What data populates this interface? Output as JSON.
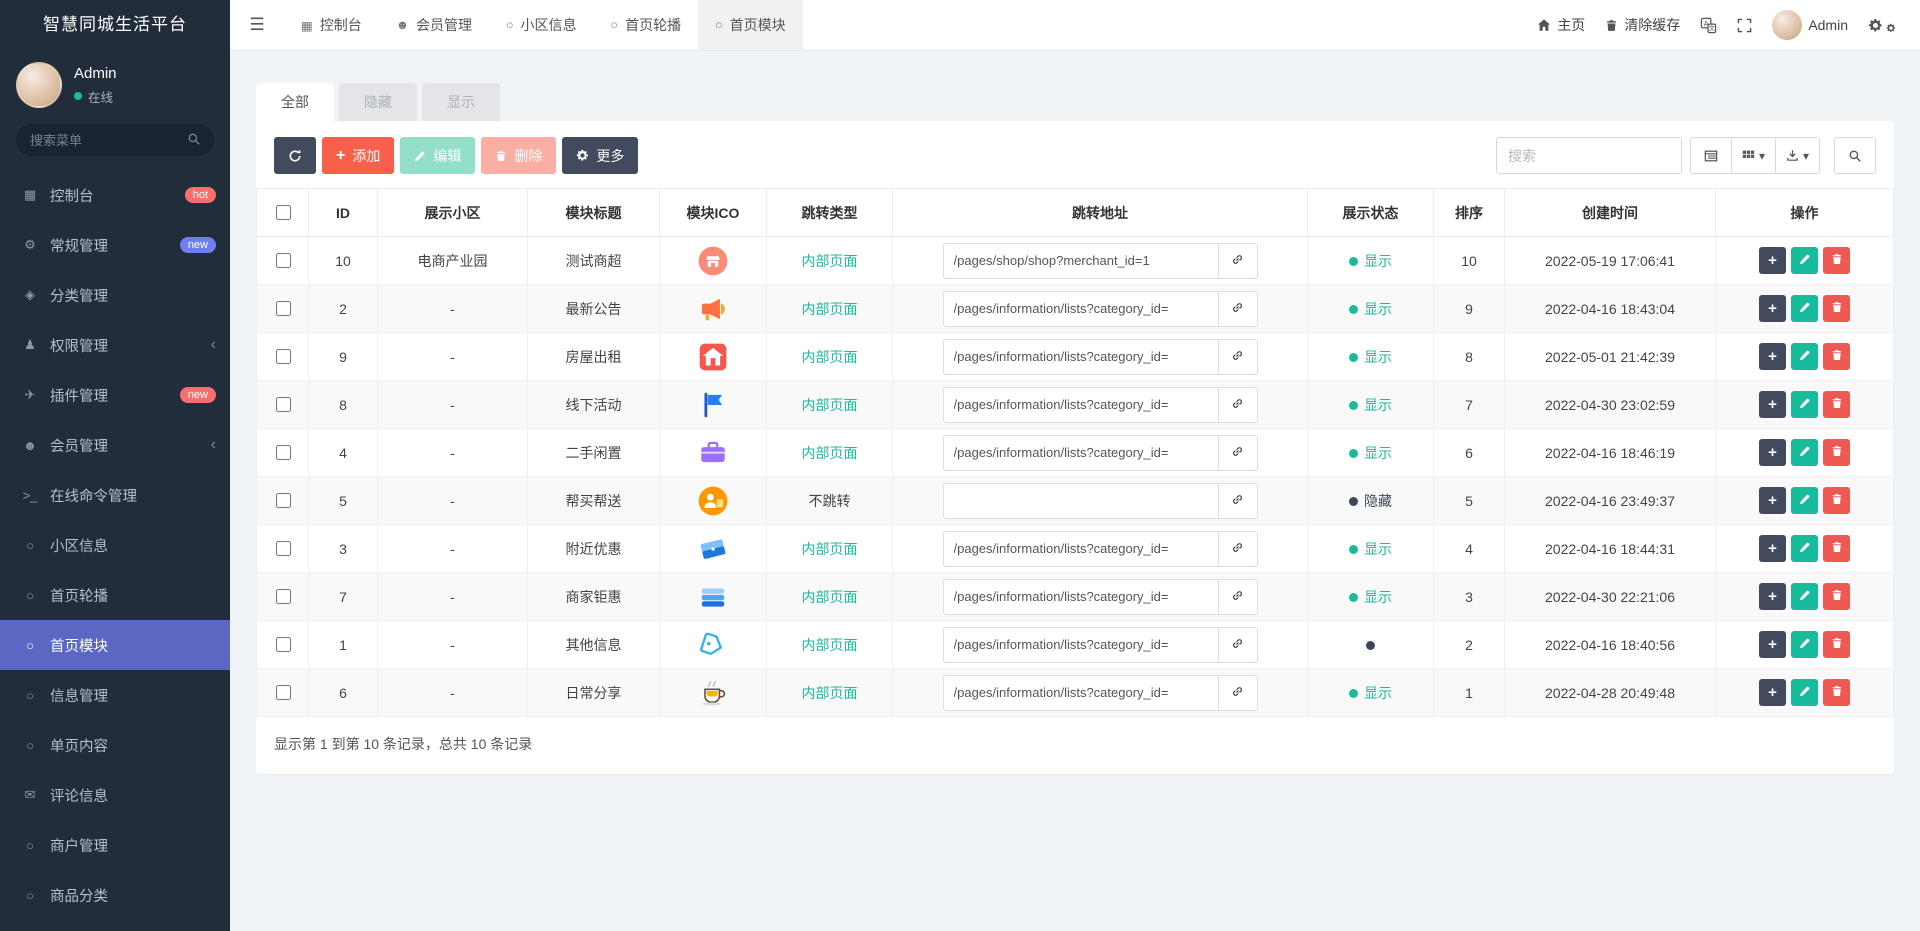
{
  "app": {
    "title": "智慧同城生活平台"
  },
  "colors": {
    "accent_green": "#18bc9c",
    "coral": "#f8604b",
    "dark_button": "#424a5e",
    "active_menu": "#5a68c4",
    "danger": "#ee5a52"
  },
  "sidebar": {
    "user": {
      "name": "Admin",
      "status": "在线"
    },
    "search_placeholder": "搜索菜单",
    "menu": [
      {
        "label": "控制台",
        "icon": "dashboard-icon",
        "glyph": "▦",
        "badge": "hot",
        "badge_color": "#fa6e6e"
      },
      {
        "label": "常规管理",
        "icon": "gears-icon",
        "glyph": "⚙",
        "badge": "new",
        "badge_color": "#6e7ff0"
      },
      {
        "label": "分类管理",
        "icon": "category-icon",
        "glyph": "◈"
      },
      {
        "label": "权限管理",
        "icon": "users-icon",
        "glyph": "♟",
        "chevron": true
      },
      {
        "label": "插件管理",
        "icon": "plugin-rocket-icon",
        "glyph": "✈",
        "badge": "new",
        "badge_color": "#fa6e6e"
      },
      {
        "label": "会员管理",
        "icon": "member-icon",
        "glyph": "☻",
        "chevron": true
      },
      {
        "label": "在线命令管理",
        "icon": "terminal-icon",
        "glyph": ">_"
      },
      {
        "label": "小区信息",
        "icon": "circle-icon",
        "glyph": "○"
      },
      {
        "label": "首页轮播",
        "icon": "circle-icon",
        "glyph": "○"
      },
      {
        "label": "首页模块",
        "icon": "circle-icon",
        "glyph": "○",
        "active": true
      },
      {
        "label": "信息管理",
        "icon": "circle-icon",
        "glyph": "○"
      },
      {
        "label": "单页内容",
        "icon": "circle-icon",
        "glyph": "○"
      },
      {
        "label": "评论信息",
        "icon": "comment-icon",
        "glyph": "✉"
      },
      {
        "label": "商户管理",
        "icon": "circle-icon",
        "glyph": "○"
      },
      {
        "label": "商品分类",
        "icon": "circle-icon",
        "glyph": "○"
      }
    ]
  },
  "topbar": {
    "tabs": [
      {
        "label": "控制台",
        "icon": "dashboard-icon",
        "glyph": "▦"
      },
      {
        "label": "会员管理",
        "icon": "user-icon",
        "glyph": "☻"
      },
      {
        "label": "小区信息",
        "icon": "circle-icon",
        "glyph": "○"
      },
      {
        "label": "首页轮播",
        "icon": "circle-icon",
        "glyph": "○"
      },
      {
        "label": "首页模块",
        "icon": "circle-icon",
        "glyph": "○",
        "active": true
      }
    ],
    "home_label": "主页",
    "clear_cache_label": "清除缓存",
    "username": "Admin"
  },
  "main": {
    "filter_tabs": [
      {
        "label": "全部",
        "state": "active"
      },
      {
        "label": "隐藏",
        "state": "disabled"
      },
      {
        "label": "显示",
        "state": "disabled"
      }
    ],
    "toolbar": {
      "add_label": "添加",
      "edit_label": "编辑",
      "delete_label": "删除",
      "more_label": "更多",
      "search_placeholder": "搜索"
    },
    "table": {
      "columns": [
        "ID",
        "展示小区",
        "模块标题",
        "模块ICO",
        "跳转类型",
        "跳转地址",
        "展示状态",
        "排序",
        "创建时间",
        "操作"
      ],
      "rows": [
        {
          "id": "10",
          "community": "电商产业园",
          "title": "测试商超",
          "ico": "shop-icon",
          "jump_type": "内部页面",
          "jump_internal": true,
          "url": "/pages/shop/shop?merchant_id=1",
          "status": "show",
          "status_label": "显示",
          "sort": "10",
          "created": "2022-05-19 17:06:41"
        },
        {
          "id": "2",
          "community": "-",
          "title": "最新公告",
          "ico": "megaphone-icon",
          "jump_type": "内部页面",
          "jump_internal": true,
          "url": "/pages/information/lists?category_id=",
          "status": "show",
          "status_label": "显示",
          "sort": "9",
          "created": "2022-04-16 18:43:04"
        },
        {
          "id": "9",
          "community": "-",
          "title": "房屋出租",
          "ico": "house-rent-icon",
          "jump_type": "内部页面",
          "jump_internal": true,
          "url": "/pages/information/lists?category_id=",
          "status": "show",
          "status_label": "显示",
          "sort": "8",
          "created": "2022-05-01 21:42:39"
        },
        {
          "id": "8",
          "community": "-",
          "title": "线下活动",
          "ico": "flag-icon",
          "jump_type": "内部页面",
          "jump_internal": true,
          "url": "/pages/information/lists?category_id=",
          "status": "show",
          "status_label": "显示",
          "sort": "7",
          "created": "2022-04-30 23:02:59"
        },
        {
          "id": "4",
          "community": "-",
          "title": "二手闲置",
          "ico": "secondhand-box-icon",
          "jump_type": "内部页面",
          "jump_internal": true,
          "url": "/pages/information/lists?category_id=",
          "status": "show",
          "status_label": "显示",
          "sort": "6",
          "created": "2022-04-16 18:46:19"
        },
        {
          "id": "5",
          "community": "-",
          "title": "帮买帮送",
          "ico": "helper-icon",
          "jump_type": "不跳转",
          "jump_internal": false,
          "url": "",
          "status": "hide",
          "status_label": "隐藏",
          "sort": "5",
          "created": "2022-04-16 23:49:37"
        },
        {
          "id": "3",
          "community": "-",
          "title": "附近优惠",
          "ico": "coupon-icon",
          "jump_type": "内部页面",
          "jump_internal": true,
          "url": "/pages/information/lists?category_id=",
          "status": "show",
          "status_label": "显示",
          "sort": "4",
          "created": "2022-04-16 18:44:31"
        },
        {
          "id": "7",
          "community": "-",
          "title": "商家钜惠",
          "ico": "cards-icon",
          "jump_type": "内部页面",
          "jump_internal": true,
          "url": "/pages/information/lists?category_id=",
          "status": "show",
          "status_label": "显示",
          "sort": "3",
          "created": "2022-04-30 22:21:06"
        },
        {
          "id": "1",
          "community": "-",
          "title": "其他信息",
          "ico": "tag-icon",
          "jump_type": "内部页面",
          "jump_internal": true,
          "url": "/pages/information/lists?category_id=",
          "status": "none",
          "status_label": "",
          "sort": "2",
          "created": "2022-04-16 18:40:56"
        },
        {
          "id": "6",
          "community": "-",
          "title": "日常分享",
          "ico": "coffee-icon",
          "jump_type": "内部页面",
          "jump_internal": true,
          "url": "/pages/information/lists?category_id=",
          "status": "show",
          "status_label": "显示",
          "sort": "1",
          "created": "2022-04-28 20:49:48"
        }
      ]
    },
    "footer_text": "显示第 1 到第 10 条记录，总共 10 条记录"
  }
}
